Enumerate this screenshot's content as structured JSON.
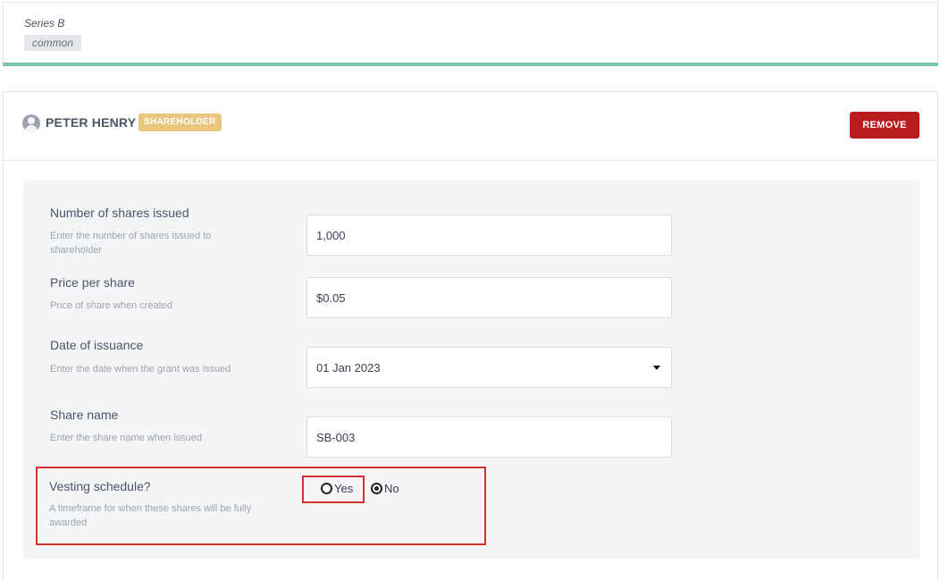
{
  "series": {
    "title": "Series B",
    "type_badge": "common"
  },
  "holder": {
    "name": "PETER HENRY",
    "role_badge": "SHAREHOLDER",
    "remove_label": "REMOVE"
  },
  "fields": [
    {
      "label": "Number of shares issued",
      "help": "Enter the number of shares issued to shareholder",
      "value": "1,000"
    },
    {
      "label": "Price per share",
      "help": "Price of share when created",
      "value": "$0.05"
    },
    {
      "label": "Date of issuance",
      "help": "Enter the date when the grant was issued",
      "value": "01 Jan 2023"
    },
    {
      "label": "Share name",
      "help": "Enter the share name when issued",
      "value": "SB-003"
    }
  ],
  "vesting": {
    "label": "Vesting schedule?",
    "help": "A timeframe for when these shares will be fully awarded",
    "options": [
      "Yes",
      "No"
    ],
    "selected": "No"
  },
  "colors": {
    "accent": "#7bc4b2",
    "remove": "#b91c1c",
    "badge": "#e9c57e",
    "highlight": "#d32f2f"
  }
}
